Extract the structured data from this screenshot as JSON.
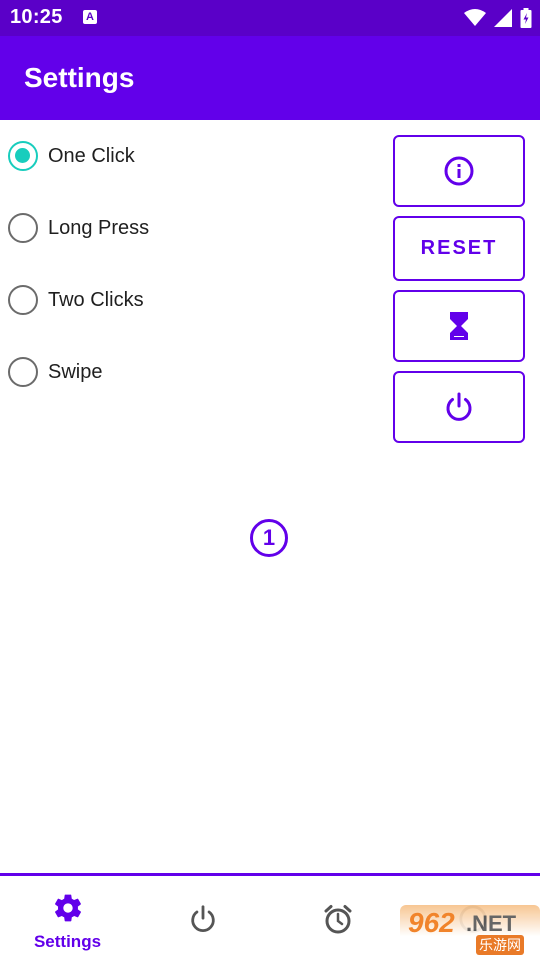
{
  "status_bar": {
    "time": "10:25",
    "badge": "A",
    "icons": [
      "wifi-icon",
      "cell-signal-icon",
      "battery-icon"
    ]
  },
  "app_bar": {
    "title": "Settings"
  },
  "colors": {
    "primary": "#6200ea",
    "status": "#5a00c8",
    "accent": "#18cdbd"
  },
  "radio_options": [
    {
      "label": "One Click",
      "checked": true
    },
    {
      "label": "Long Press",
      "checked": false
    },
    {
      "label": "Two Clicks",
      "checked": false
    },
    {
      "label": "Swipe",
      "checked": false
    }
  ],
  "side_buttons": {
    "info_icon": "info-icon",
    "reset_label": "RESET",
    "timer_icon": "hourglass-icon",
    "power_icon": "power-icon"
  },
  "counter": {
    "value": "1"
  },
  "bottom_nav": [
    {
      "label": "Settings",
      "icon": "gear-icon",
      "active": true
    },
    {
      "label": "",
      "icon": "power-icon",
      "active": false
    },
    {
      "label": "",
      "icon": "alarm-clock-icon",
      "active": false
    },
    {
      "label": "",
      "icon": "help-icon",
      "active": false
    }
  ],
  "watermark": {
    "number": "962",
    "suffix": ".NET",
    "subtitle": "乐游网"
  }
}
